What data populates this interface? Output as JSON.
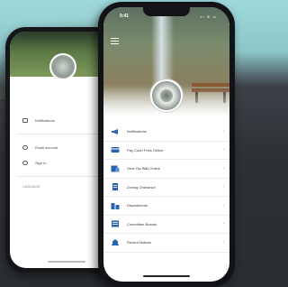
{
  "colors": {
    "accent": "#2a64b0",
    "icon_blue": "#2a64b0",
    "text": "#3a3a3a"
  },
  "back_phone": {
    "menu": [
      {
        "label": "Notifications",
        "icon": "notification-icon"
      },
      {
        "label": "Email account",
        "icon": "account-icon"
      },
      {
        "label": "Sign In",
        "icon": "user-icon"
      }
    ],
    "section_label": "LANGUAGE"
  },
  "front_phone": {
    "status_time": "9:41",
    "status_icons": "▪▪ ≋ ▭",
    "menu": [
      {
        "label": "Notifications",
        "icon": "megaphone-icon"
      },
      {
        "label": "Pay Court Fees Online",
        "icon": "credit-card-icon"
      },
      {
        "label": "View Tax Bills Online",
        "icon": "tax-bill-icon"
      },
      {
        "label": "Zoning Ordinance",
        "icon": "document-icon"
      },
      {
        "label": "Departments",
        "icon": "buildings-icon"
      },
      {
        "label": "Committee Boards",
        "icon": "clipboard-icon"
      },
      {
        "label": "Recent Notices",
        "icon": "bell-icon"
      }
    ],
    "chevron": "›"
  }
}
